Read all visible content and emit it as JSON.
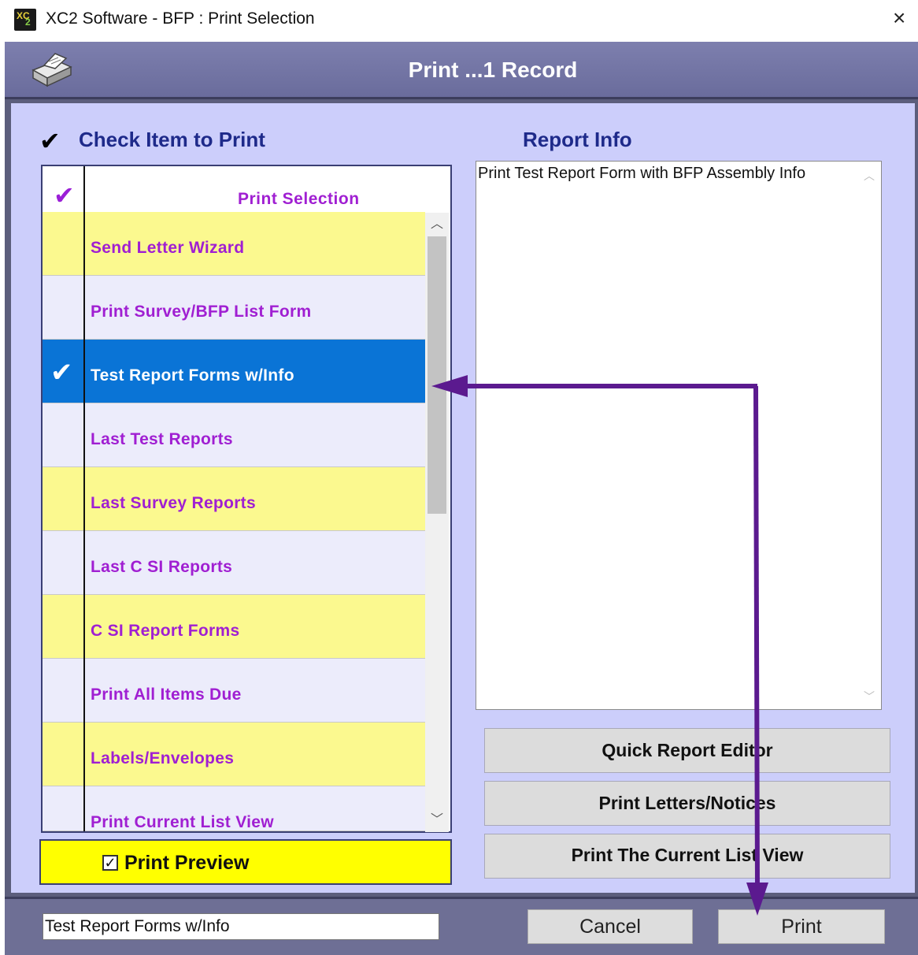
{
  "window": {
    "title": "XC2 Software - BFP : Print Selection",
    "close_label": "×",
    "icon_text_a": "XC",
    "icon_text_b": "2"
  },
  "header": {
    "title": "Print ...1 Record",
    "icon": "printer-icon"
  },
  "list_heading": "Check Item to Print",
  "report_heading": "Report Info",
  "list": {
    "header_label": "Print  Selection",
    "items": [
      {
        "label": "Send  Letter  Wizard",
        "style": "yellow",
        "checked": false
      },
      {
        "label": "Print  Survey/BFP  List  Form",
        "style": "lav",
        "checked": false
      },
      {
        "label": "Test Report Forms w/Info",
        "style": "selected",
        "checked": true
      },
      {
        "label": "Last  Test  Reports",
        "style": "lav",
        "checked": false
      },
      {
        "label": "Last  Survey  Reports",
        "style": "yellow",
        "checked": false
      },
      {
        "label": "Last  C SI  Reports",
        "style": "lav",
        "checked": false
      },
      {
        "label": "C SI  Report  Forms",
        "style": "yellow",
        "checked": false
      },
      {
        "label": "Print  All  Items  Due",
        "style": "lav",
        "checked": false
      },
      {
        "label": "Labels/Envelopes",
        "style": "yellow",
        "checked": false
      },
      {
        "label": "Print  Current  List  View",
        "style": "lav",
        "checked": false
      }
    ]
  },
  "print_preview": {
    "label": "Print Preview",
    "checked": true
  },
  "report_info": {
    "text": "Print Test Report Form with BFP Assembly Info"
  },
  "buttons": {
    "quick_report_editor": "Quick Report Editor",
    "print_letters_notices": "Print Letters/Notices",
    "print_current_list_view": "Print The Current List View"
  },
  "footer": {
    "selected_item": "Test Report Forms w/Info",
    "cancel": "Cancel",
    "print": "Print"
  },
  "colors": {
    "header_band": "#7d7fae",
    "panel": "#cccefb",
    "item_text": "#a01fd2",
    "selected_row": "#0a74d6",
    "yellow_row": "#fbf98f",
    "annotation_arrow": "#5b1a8f"
  }
}
